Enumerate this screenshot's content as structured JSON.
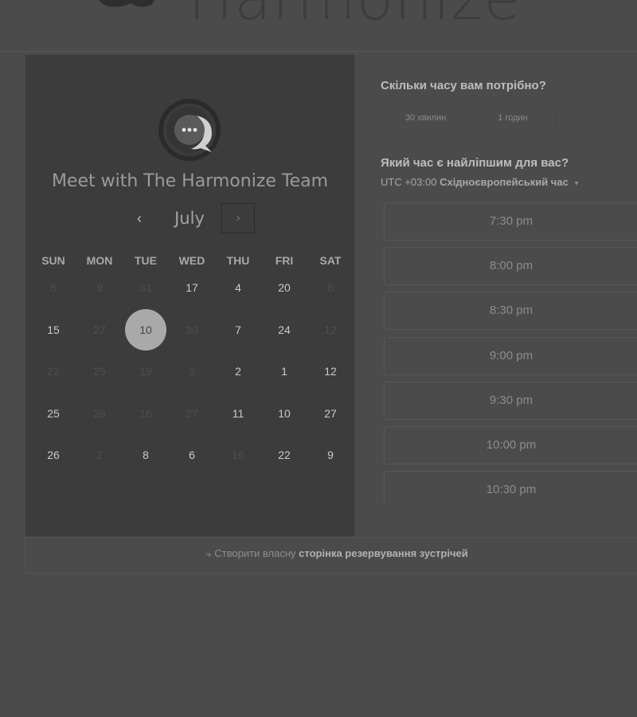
{
  "brand": {
    "name": "Harmonize"
  },
  "calendar": {
    "title": "Meet with The Harmonize Team",
    "month": "July",
    "prev_icon": "‹",
    "next_icon": "›",
    "weekdays": [
      "SUN",
      "MON",
      "TUE",
      "WED",
      "THU",
      "FRI",
      "SAT"
    ],
    "weeks": [
      [
        {
          "d": "6",
          "a": false
        },
        {
          "d": "9",
          "a": false
        },
        {
          "d": "31",
          "a": false
        },
        {
          "d": "17",
          "a": true
        },
        {
          "d": "4",
          "a": true
        },
        {
          "d": "20",
          "a": true
        },
        {
          "d": "6",
          "a": false
        }
      ],
      [
        {
          "d": "15",
          "a": true
        },
        {
          "d": "27",
          "a": false
        },
        {
          "d": "10",
          "a": true,
          "s": true
        },
        {
          "d": "30",
          "a": false
        },
        {
          "d": "7",
          "a": true
        },
        {
          "d": "24",
          "a": true
        },
        {
          "d": "12",
          "a": false
        }
      ],
      [
        {
          "d": "22",
          "a": false
        },
        {
          "d": "25",
          "a": false
        },
        {
          "d": "19",
          "a": false
        },
        {
          "d": "3",
          "a": false
        },
        {
          "d": "2",
          "a": true
        },
        {
          "d": "1",
          "a": true
        },
        {
          "d": "12",
          "a": true
        }
      ],
      [
        {
          "d": "25",
          "a": true
        },
        {
          "d": "28",
          "a": false
        },
        {
          "d": "16",
          "a": false
        },
        {
          "d": "27",
          "a": false
        },
        {
          "d": "11",
          "a": true
        },
        {
          "d": "10",
          "a": true
        },
        {
          "d": "27",
          "a": true
        }
      ],
      [
        {
          "d": "26",
          "a": true
        },
        {
          "d": "2",
          "a": false
        },
        {
          "d": "8",
          "a": true
        },
        {
          "d": "6",
          "a": true
        },
        {
          "d": "16",
          "a": false
        },
        {
          "d": "22",
          "a": true
        },
        {
          "d": "9",
          "a": true
        }
      ]
    ]
  },
  "booking": {
    "duration_question": "Скільки часу вам потрібно?",
    "durations": [
      "30 хвилин",
      "1 годин"
    ],
    "time_question": "Який час є найліпшим для вас?",
    "timezone_offset": "UTC +03:00",
    "timezone_name": "Східноєвропейський час",
    "timezone_caret": "▾",
    "slots": [
      "7:30 pm",
      "8:00 pm",
      "8:30 pm",
      "9:00 pm",
      "9:30 pm",
      "10:00 pm",
      "10:30 pm"
    ]
  },
  "footer": {
    "icon": "⤷",
    "text": "Створити власну",
    "link_bold": "сторінка резервування зустрічей"
  },
  "colors": {
    "background": "#4b4b4b",
    "panel": "#3c3c3c",
    "selected_day": "#a9a9a9"
  }
}
